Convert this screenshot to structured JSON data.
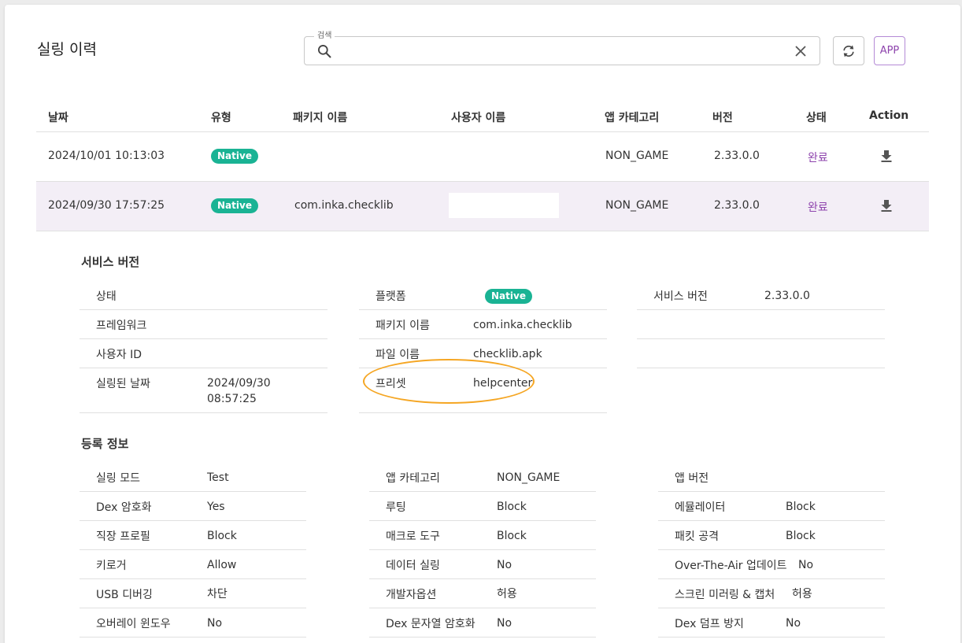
{
  "page": {
    "title": "실링 이력"
  },
  "search": {
    "legend": "검색",
    "value": ""
  },
  "toolbar": {
    "app_label": "APP"
  },
  "table": {
    "headers": [
      "날짜",
      "유형",
      "패키지 이름",
      "사용자 이름",
      "앱 카테고리",
      "버전",
      "상태",
      "Action"
    ],
    "rows": [
      {
        "date": "2024/10/01 10:13:03",
        "type": "Native",
        "package": "",
        "user": "",
        "category": "NON_GAME",
        "version": "2.33.0.0",
        "status": "완료"
      },
      {
        "date": "2024/09/30 17:57:25",
        "type": "Native",
        "package": "com.inka.checklib",
        "user": "",
        "category": "NON_GAME",
        "version": "2.33.0.0",
        "status": "완료"
      }
    ]
  },
  "service": {
    "title": "서비스 버전",
    "col1": [
      {
        "k": "상태",
        "v": ""
      },
      {
        "k": "프레임워크",
        "v": ""
      },
      {
        "k": "사용자 ID",
        "v": ""
      },
      {
        "k": "실링된 날짜",
        "v": "2024/09/30",
        "v2": "08:57:25"
      }
    ],
    "col2": [
      {
        "k": "플랫폼",
        "v": "Native"
      },
      {
        "k": "패키지 이름",
        "v": "com.inka.checklib"
      },
      {
        "k": "파일 이름",
        "v": "checklib.apk"
      },
      {
        "k": "프리셋",
        "v": "helpcenter"
      }
    ],
    "col3": [
      {
        "k": "서비스 버전",
        "v": "2.33.0.0"
      }
    ]
  },
  "register": {
    "title": "등록 정보",
    "col1": [
      {
        "k": "실링 모드",
        "v": "Test"
      },
      {
        "k": "Dex 암호화",
        "v": "Yes"
      },
      {
        "k": "직장 프로필",
        "v": "Block"
      },
      {
        "k": "키로거",
        "v": "Allow"
      },
      {
        "k": "USB 디버깅",
        "v": "차단"
      },
      {
        "k": "오버레이 윈도우",
        "v": "No"
      }
    ],
    "col2": [
      {
        "k": "앱 카테고리",
        "v": "NON_GAME"
      },
      {
        "k": "루팅",
        "v": "Block"
      },
      {
        "k": "매크로 도구",
        "v": "Block"
      },
      {
        "k": "데이터 실링",
        "v": "No"
      },
      {
        "k": "개발자옵션",
        "v": "허용"
      },
      {
        "k": "Dex 문자열 암호화",
        "v": "No"
      }
    ],
    "col3": [
      {
        "k": "앱 버전",
        "v": ""
      },
      {
        "k": "에뮬레이터",
        "v": "Block"
      },
      {
        "k": "패킷 공격",
        "v": "Block"
      },
      {
        "k": "Over-The-Air 업데이트",
        "v": "No"
      },
      {
        "k": "스크린 미러링 & 캡처",
        "v": "허용"
      },
      {
        "k": "Dex 덤프 방지",
        "v": "No"
      }
    ]
  }
}
